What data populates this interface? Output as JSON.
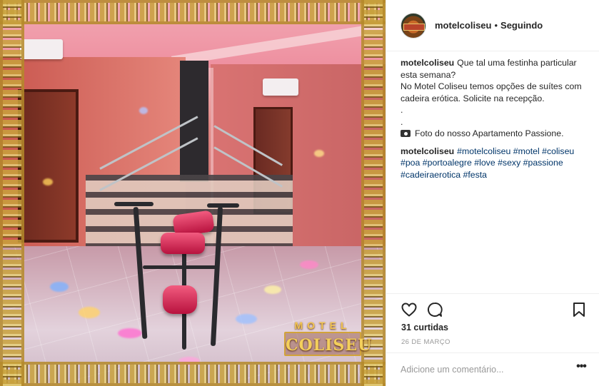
{
  "post": {
    "photo_logo_top": "MOTEL",
    "photo_logo_main": "COLISEU"
  },
  "header": {
    "username": "motelcoliseu",
    "separator": "•",
    "follow_status": "Seguindo"
  },
  "caption": {
    "username": "motelcoliseu",
    "line1": "Que tal uma festinha particular esta semana?",
    "line2": "No Motel Coliseu temos opções de suítes com cadeira erótica. Solicite na recepção.",
    "dot1": ".",
    "dot2": ".",
    "line3": "Foto do nosso Apartamento Passione."
  },
  "hashtag_comment": {
    "username": "motelcoliseu",
    "tags": [
      "#motelcoliseu",
      "#motel",
      "#coliseu",
      "#poa",
      "#portoalegre",
      "#love",
      "#sexy",
      "#passione",
      "#cadeiraerotica",
      "#festa"
    ]
  },
  "engagement": {
    "likes": "31 curtidas",
    "date": "26 DE MARÇO"
  },
  "comment_box": {
    "placeholder": "Adicione um comentário..."
  },
  "icons": {
    "like": "heart-icon",
    "comment": "comment-bubble-icon",
    "save": "bookmark-icon",
    "more": "more-options-icon",
    "caption_camera": "camera-icon"
  }
}
